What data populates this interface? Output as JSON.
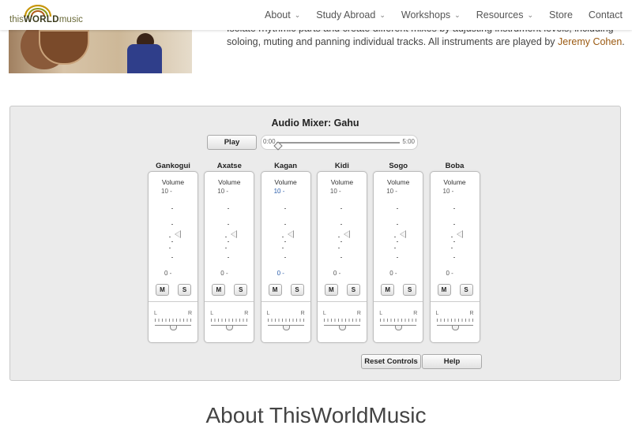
{
  "header": {
    "logo": {
      "text_this": "this",
      "text_world": "WORLD",
      "text_music": "music"
    },
    "nav": [
      {
        "label": "About",
        "has_dropdown": true
      },
      {
        "label": "Study Abroad",
        "has_dropdown": true
      },
      {
        "label": "Workshops",
        "has_dropdown": true
      },
      {
        "label": "Resources",
        "has_dropdown": true
      },
      {
        "label": "Store",
        "has_dropdown": false
      },
      {
        "label": "Contact",
        "has_dropdown": false
      }
    ]
  },
  "intro": {
    "line1": "Isolate rhythmic parts and create different mixes by adjusting instrument levels, including",
    "line2_prefix": "soloing, muting and panning individual tracks. All instruments are played by ",
    "line2_link": "Jeremy Cohen",
    "line2_suffix": "."
  },
  "mixer": {
    "title": "Audio Mixer: Gahu",
    "play_label": "Play",
    "time_start": "0:00",
    "time_end": "5:00",
    "progress": 0.0,
    "channels": [
      {
        "name": "Gankogui",
        "volume_label": "Volume",
        "max_label": "10 -",
        "min_label": "0 -",
        "mute_label": "M",
        "solo_label": "S",
        "pan_left": "L",
        "pan_right": "R",
        "volume_level": 0.5,
        "pan": 0.5
      },
      {
        "name": "Axatse",
        "volume_label": "Volume",
        "max_label": "10 -",
        "min_label": "0 -",
        "mute_label": "M",
        "solo_label": "S",
        "pan_left": "L",
        "pan_right": "R",
        "volume_level": 0.5,
        "pan": 0.5
      },
      {
        "name": "Kagan",
        "volume_label": "Volume",
        "max_label": "10 -",
        "min_label": "0 -",
        "mute_label": "M",
        "solo_label": "S",
        "pan_left": "L",
        "pan_right": "R",
        "volume_level": 0.5,
        "pan": 0.5
      },
      {
        "name": "Kidi",
        "volume_label": "Volume",
        "max_label": "10 -",
        "min_label": "0 -",
        "mute_label": "M",
        "solo_label": "S",
        "pan_left": "L",
        "pan_right": "R",
        "volume_level": 0.5,
        "pan": 0.5
      },
      {
        "name": "Sogo",
        "volume_label": "Volume",
        "max_label": "10 -",
        "min_label": "0 -",
        "mute_label": "M",
        "solo_label": "S",
        "pan_left": "L",
        "pan_right": "R",
        "volume_level": 0.5,
        "pan": 0.5
      },
      {
        "name": "Boba",
        "volume_label": "Volume",
        "max_label": "10 -",
        "min_label": "0 -",
        "mute_label": "M",
        "solo_label": "S",
        "pan_left": "L",
        "pan_right": "R",
        "volume_level": 0.5,
        "pan": 0.5
      }
    ],
    "reset_label": "Reset Controls",
    "help_label": "Help"
  },
  "about_heading": "About ThisWorldMusic",
  "colors": {
    "link": "#9b5a12",
    "panel_bg": "#ebebeb",
    "logo_gold": "#c8960a"
  }
}
